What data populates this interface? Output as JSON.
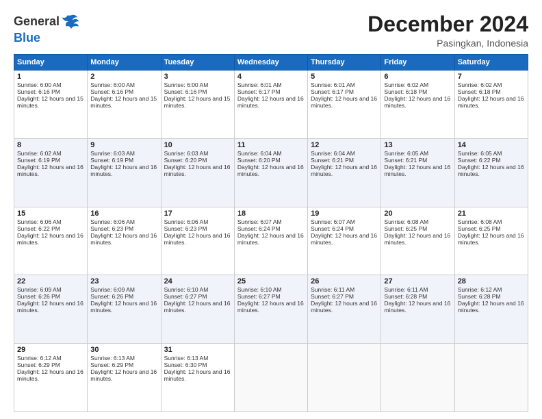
{
  "header": {
    "logo_general": "General",
    "logo_blue": "Blue",
    "title": "December 2024",
    "subtitle": "Pasingkan, Indonesia"
  },
  "columns": [
    "Sunday",
    "Monday",
    "Tuesday",
    "Wednesday",
    "Thursday",
    "Friday",
    "Saturday"
  ],
  "weeks": [
    [
      {
        "day": "1",
        "sunrise": "Sunrise: 6:00 AM",
        "sunset": "Sunset: 6:16 PM",
        "daylight": "Daylight: 12 hours and 15 minutes."
      },
      {
        "day": "2",
        "sunrise": "Sunrise: 6:00 AM",
        "sunset": "Sunset: 6:16 PM",
        "daylight": "Daylight: 12 hours and 15 minutes."
      },
      {
        "day": "3",
        "sunrise": "Sunrise: 6:00 AM",
        "sunset": "Sunset: 6:16 PM",
        "daylight": "Daylight: 12 hours and 15 minutes."
      },
      {
        "day": "4",
        "sunrise": "Sunrise: 6:01 AM",
        "sunset": "Sunset: 6:17 PM",
        "daylight": "Daylight: 12 hours and 16 minutes."
      },
      {
        "day": "5",
        "sunrise": "Sunrise: 6:01 AM",
        "sunset": "Sunset: 6:17 PM",
        "daylight": "Daylight: 12 hours and 16 minutes."
      },
      {
        "day": "6",
        "sunrise": "Sunrise: 6:02 AM",
        "sunset": "Sunset: 6:18 PM",
        "daylight": "Daylight: 12 hours and 16 minutes."
      },
      {
        "day": "7",
        "sunrise": "Sunrise: 6:02 AM",
        "sunset": "Sunset: 6:18 PM",
        "daylight": "Daylight: 12 hours and 16 minutes."
      }
    ],
    [
      {
        "day": "8",
        "sunrise": "Sunrise: 6:02 AM",
        "sunset": "Sunset: 6:19 PM",
        "daylight": "Daylight: 12 hours and 16 minutes."
      },
      {
        "day": "9",
        "sunrise": "Sunrise: 6:03 AM",
        "sunset": "Sunset: 6:19 PM",
        "daylight": "Daylight: 12 hours and 16 minutes."
      },
      {
        "day": "10",
        "sunrise": "Sunrise: 6:03 AM",
        "sunset": "Sunset: 6:20 PM",
        "daylight": "Daylight: 12 hours and 16 minutes."
      },
      {
        "day": "11",
        "sunrise": "Sunrise: 6:04 AM",
        "sunset": "Sunset: 6:20 PM",
        "daylight": "Daylight: 12 hours and 16 minutes."
      },
      {
        "day": "12",
        "sunrise": "Sunrise: 6:04 AM",
        "sunset": "Sunset: 6:21 PM",
        "daylight": "Daylight: 12 hours and 16 minutes."
      },
      {
        "day": "13",
        "sunrise": "Sunrise: 6:05 AM",
        "sunset": "Sunset: 6:21 PM",
        "daylight": "Daylight: 12 hours and 16 minutes."
      },
      {
        "day": "14",
        "sunrise": "Sunrise: 6:05 AM",
        "sunset": "Sunset: 6:22 PM",
        "daylight": "Daylight: 12 hours and 16 minutes."
      }
    ],
    [
      {
        "day": "15",
        "sunrise": "Sunrise: 6:06 AM",
        "sunset": "Sunset: 6:22 PM",
        "daylight": "Daylight: 12 hours and 16 minutes."
      },
      {
        "day": "16",
        "sunrise": "Sunrise: 6:06 AM",
        "sunset": "Sunset: 6:23 PM",
        "daylight": "Daylight: 12 hours and 16 minutes."
      },
      {
        "day": "17",
        "sunrise": "Sunrise: 6:06 AM",
        "sunset": "Sunset: 6:23 PM",
        "daylight": "Daylight: 12 hours and 16 minutes."
      },
      {
        "day": "18",
        "sunrise": "Sunrise: 6:07 AM",
        "sunset": "Sunset: 6:24 PM",
        "daylight": "Daylight: 12 hours and 16 minutes."
      },
      {
        "day": "19",
        "sunrise": "Sunrise: 6:07 AM",
        "sunset": "Sunset: 6:24 PM",
        "daylight": "Daylight: 12 hours and 16 minutes."
      },
      {
        "day": "20",
        "sunrise": "Sunrise: 6:08 AM",
        "sunset": "Sunset: 6:25 PM",
        "daylight": "Daylight: 12 hours and 16 minutes."
      },
      {
        "day": "21",
        "sunrise": "Sunrise: 6:08 AM",
        "sunset": "Sunset: 6:25 PM",
        "daylight": "Daylight: 12 hours and 16 minutes."
      }
    ],
    [
      {
        "day": "22",
        "sunrise": "Sunrise: 6:09 AM",
        "sunset": "Sunset: 6:26 PM",
        "daylight": "Daylight: 12 hours and 16 minutes."
      },
      {
        "day": "23",
        "sunrise": "Sunrise: 6:09 AM",
        "sunset": "Sunset: 6:26 PM",
        "daylight": "Daylight: 12 hours and 16 minutes."
      },
      {
        "day": "24",
        "sunrise": "Sunrise: 6:10 AM",
        "sunset": "Sunset: 6:27 PM",
        "daylight": "Daylight: 12 hours and 16 minutes."
      },
      {
        "day": "25",
        "sunrise": "Sunrise: 6:10 AM",
        "sunset": "Sunset: 6:27 PM",
        "daylight": "Daylight: 12 hours and 16 minutes."
      },
      {
        "day": "26",
        "sunrise": "Sunrise: 6:11 AM",
        "sunset": "Sunset: 6:27 PM",
        "daylight": "Daylight: 12 hours and 16 minutes."
      },
      {
        "day": "27",
        "sunrise": "Sunrise: 6:11 AM",
        "sunset": "Sunset: 6:28 PM",
        "daylight": "Daylight: 12 hours and 16 minutes."
      },
      {
        "day": "28",
        "sunrise": "Sunrise: 6:12 AM",
        "sunset": "Sunset: 6:28 PM",
        "daylight": "Daylight: 12 hours and 16 minutes."
      }
    ],
    [
      {
        "day": "29",
        "sunrise": "Sunrise: 6:12 AM",
        "sunset": "Sunset: 6:29 PM",
        "daylight": "Daylight: 12 hours and 16 minutes."
      },
      {
        "day": "30",
        "sunrise": "Sunrise: 6:13 AM",
        "sunset": "Sunset: 6:29 PM",
        "daylight": "Daylight: 12 hours and 16 minutes."
      },
      {
        "day": "31",
        "sunrise": "Sunrise: 6:13 AM",
        "sunset": "Sunset: 6:30 PM",
        "daylight": "Daylight: 12 hours and 16 minutes."
      },
      null,
      null,
      null,
      null
    ]
  ]
}
